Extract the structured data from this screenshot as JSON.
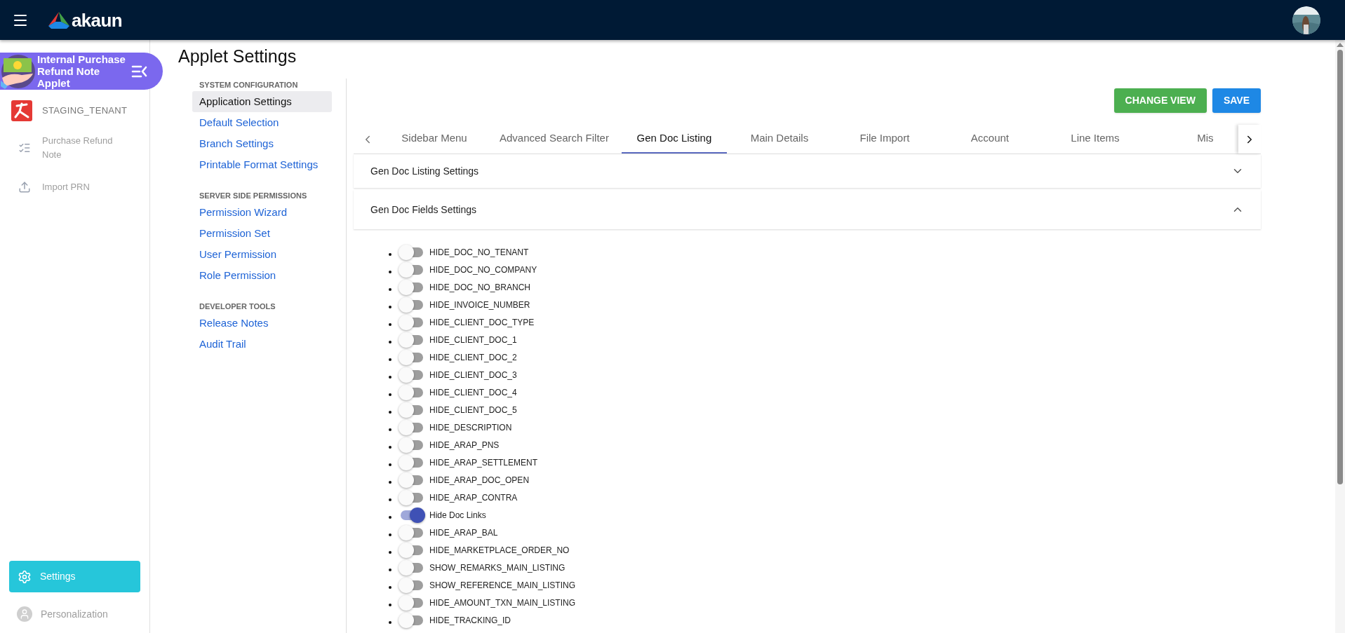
{
  "header": {
    "logo_text": "akaun"
  },
  "applet": {
    "title": "Internal Purchase Refund Note Applet"
  },
  "sidebar": {
    "tenant": "STAGING_TENANT",
    "items": [
      {
        "label": "Purchase Refund Note",
        "kind": "list"
      },
      {
        "label": "Import PRN",
        "kind": "upload"
      }
    ],
    "settings": {
      "label": "Settings",
      "selected": true
    },
    "personalization": {
      "label": "Personalization"
    }
  },
  "page_title": "Applet Settings",
  "settings_nav": [
    {
      "heading": "SYSTEM CONFIGURATION",
      "items": [
        {
          "label": "Application Settings",
          "selected": true
        },
        {
          "label": "Default Selection",
          "selected": false
        },
        {
          "label": "Branch Settings",
          "selected": false
        },
        {
          "label": "Printable Format Settings",
          "selected": false
        }
      ]
    },
    {
      "heading": "SERVER SIDE PERMISSIONS",
      "items": [
        {
          "label": "Permission Wizard",
          "selected": false
        },
        {
          "label": "Permission Set",
          "selected": false
        },
        {
          "label": "User Permission",
          "selected": false
        },
        {
          "label": "Role Permission",
          "selected": false
        }
      ]
    },
    {
      "heading": "DEVELOPER TOOLS",
      "items": [
        {
          "label": "Release Notes",
          "selected": false
        },
        {
          "label": "Audit Trail",
          "selected": false
        }
      ]
    }
  ],
  "buttons": [
    {
      "label": "CHANGE VIEW",
      "kind": "secondary"
    },
    {
      "label": "SAVE",
      "kind": "primary"
    }
  ],
  "tabs": [
    {
      "label": "Sidebar Menu",
      "selected": false
    },
    {
      "label": "Advanced Search Filter",
      "selected": false
    },
    {
      "label": "Gen Doc Listing",
      "selected": true
    },
    {
      "label": "Main Details",
      "selected": false
    },
    {
      "label": "File Import",
      "selected": false
    },
    {
      "label": "Account",
      "selected": false
    },
    {
      "label": "Line Items",
      "selected": false
    },
    {
      "label": "Mis",
      "selected": false
    }
  ],
  "panels": [
    {
      "title": "Gen Doc Listing Settings",
      "expanded": false
    },
    {
      "title": "Gen Doc Fields Settings",
      "expanded": true,
      "fields": [
        {
          "label": "HIDE_DOC_NO_TENANT",
          "on": false
        },
        {
          "label": "HIDE_DOC_NO_COMPANY",
          "on": false
        },
        {
          "label": "HIDE_DOC_NO_BRANCH",
          "on": false
        },
        {
          "label": "HIDE_INVOICE_NUMBER",
          "on": false
        },
        {
          "label": "HIDE_CLIENT_DOC_TYPE",
          "on": false
        },
        {
          "label": "HIDE_CLIENT_DOC_1",
          "on": false
        },
        {
          "label": "HIDE_CLIENT_DOC_2",
          "on": false
        },
        {
          "label": "HIDE_CLIENT_DOC_3",
          "on": false
        },
        {
          "label": "HIDE_CLIENT_DOC_4",
          "on": false
        },
        {
          "label": "HIDE_CLIENT_DOC_5",
          "on": false
        },
        {
          "label": "HIDE_DESCRIPTION",
          "on": false
        },
        {
          "label": "HIDE_ARAP_PNS",
          "on": false
        },
        {
          "label": "HIDE_ARAP_SETTLEMENT",
          "on": false
        },
        {
          "label": "HIDE_ARAP_DOC_OPEN",
          "on": false
        },
        {
          "label": "HIDE_ARAP_CONTRA",
          "on": false
        },
        {
          "label": "Hide Doc Links",
          "on": true
        },
        {
          "label": "HIDE_ARAP_BAL",
          "on": false
        },
        {
          "label": "HIDE_MARKETPLACE_ORDER_NO",
          "on": false
        },
        {
          "label": "SHOW_REMARKS_MAIN_LISTING",
          "on": false
        },
        {
          "label": "SHOW_REFERENCE_MAIN_LISTING",
          "on": false
        },
        {
          "label": "HIDE_AMOUNT_TXN_MAIN_LISTING",
          "on": false
        },
        {
          "label": "HIDE_TRACKING_ID",
          "on": false
        }
      ]
    }
  ]
}
